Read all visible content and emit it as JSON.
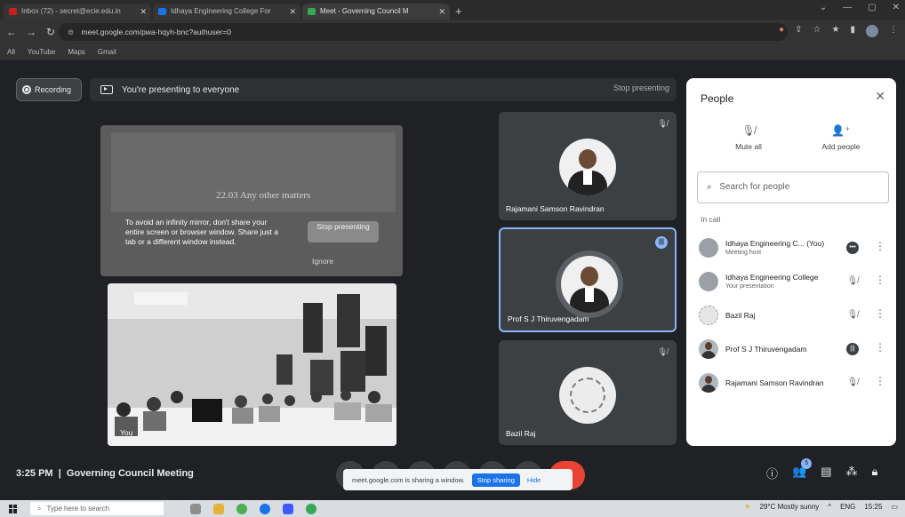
{
  "browser": {
    "tabs": [
      {
        "label": "Inbox (72) - secret@ecie.edu.in"
      },
      {
        "label": "Idhaya Engineering College For"
      },
      {
        "label": "Meet - Governing Council M"
      }
    ],
    "url": "meet.google.com/pwa-hqyh-bnc?authuser=0",
    "bookmarks": [
      "All",
      "YouTube",
      "Maps",
      "Gmail"
    ]
  },
  "meet": {
    "recording_label": "Recording",
    "presenting_text": "You're presenting to everyone",
    "stop_presenting_label": "Stop presenting",
    "presentation": {
      "agenda_text": "22.03 Any other matters",
      "mirror_warning": "To avoid an infinity mirror, don't share your entire screen or browser window. Share just a tab or a different window instead.",
      "stop_button": "Stop presenting",
      "ignore_button": "Ignore"
    },
    "room_tile_name": "You",
    "participants": [
      {
        "name": "Rajamani Samson Ravindran"
      },
      {
        "name": "Prof S J Thiruvengadam"
      },
      {
        "name": "Bazil Raj"
      }
    ],
    "time": "3:25 PM",
    "meeting_title": "Governing Council Meeting",
    "share_notice": {
      "text": "meet.google.com is sharing a window.",
      "stop": "Stop sharing",
      "hide": "Hide"
    },
    "people_count": "5"
  },
  "people_panel": {
    "title": "People",
    "mute_all": "Mute all",
    "add_people": "Add people",
    "search_placeholder": "Search for people",
    "section": "In call",
    "rows": [
      {
        "name": "Idhaya Engineering C... (You)",
        "sub": "Meeting host"
      },
      {
        "name": "Idhaya Engineering College",
        "sub": "Your presentation"
      },
      {
        "name": "Bazil Raj",
        "sub": ""
      },
      {
        "name": "Prof S J Thiruvengadam",
        "sub": ""
      },
      {
        "name": "Rajamani Samson Ravindran",
        "sub": ""
      }
    ]
  },
  "taskbar": {
    "search_placeholder": "Type here to search",
    "weather": "29°C Mostly sunny",
    "lang": "ENG",
    "clock": "15:25"
  },
  "colors": {
    "meet_bg": "#202124",
    "tile_bg": "#3c4043",
    "accent": "#8ab4f8",
    "end_call": "#ea4335"
  }
}
